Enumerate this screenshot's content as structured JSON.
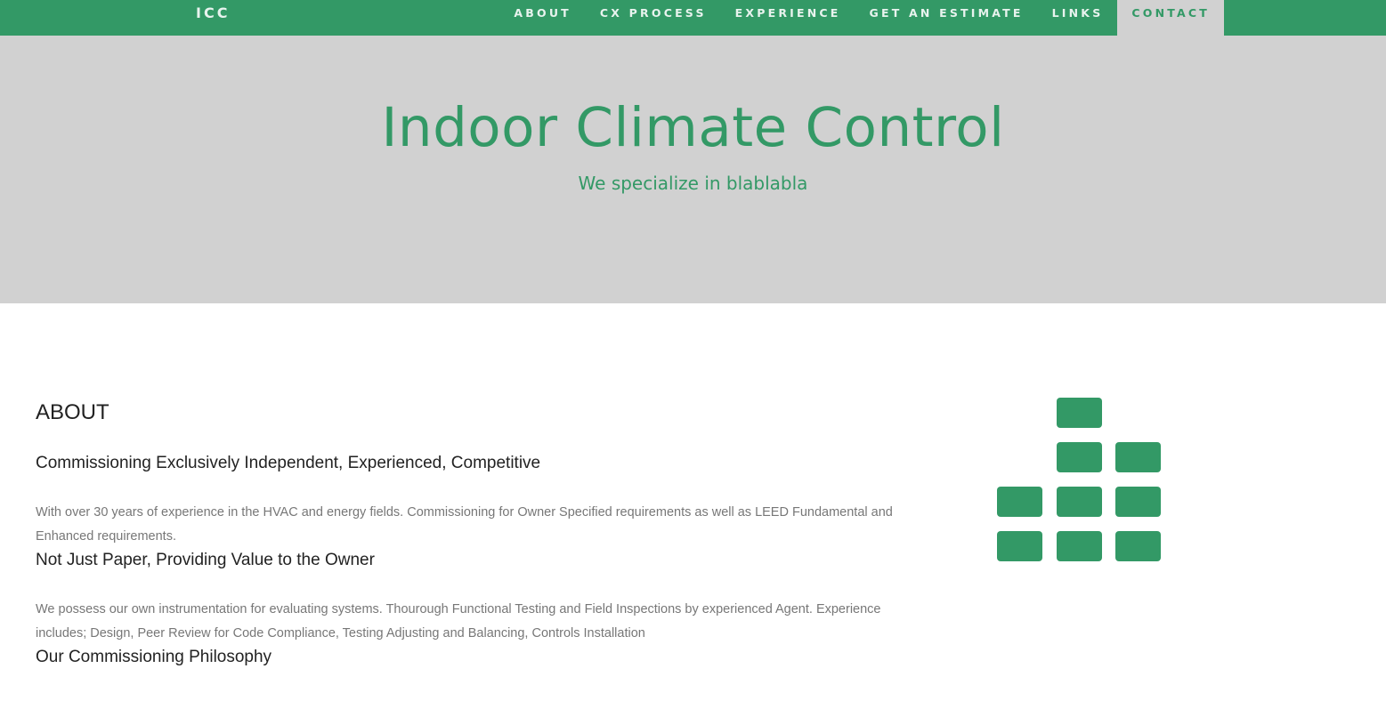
{
  "nav": {
    "brand": "ICC",
    "items": [
      {
        "label": "ABOUT"
      },
      {
        "label": "CX PROCESS"
      },
      {
        "label": "EXPERIENCE"
      },
      {
        "label": "GET AN ESTIMATE"
      },
      {
        "label": "LINKS"
      },
      {
        "label": "CONTACT"
      }
    ],
    "active_item": "CONTACT"
  },
  "hero": {
    "title": "Indoor Climate Control",
    "subtitle": "We specialize in blablabla"
  },
  "about": {
    "heading": "ABOUT",
    "sections": [
      {
        "title": "Commissioning Exclusively Independent, Experienced, Competitive",
        "text": "With over 30 years of experience in the HVAC and energy fields. Commissioning for Owner Specified requirements as well as LEED Fundamental and Enhanced requirements."
      },
      {
        "title": "Not Just Paper, Providing Value to the Owner",
        "text": "We possess our own instrumentation for evaluating systems. Thourough Functional Testing and Field Inspections by experienced Agent. Experience includes; Design, Peer Review for Code Compliance, Testing Adjusting and Balancing, Controls Installation"
      },
      {
        "title": "Our Commissioning Philosophy"
      }
    ]
  },
  "colors": {
    "brand_green": "#339966",
    "hero_background": "#d1d1d1"
  },
  "icons": {
    "logo": "bar-graph-blocks-icon"
  }
}
